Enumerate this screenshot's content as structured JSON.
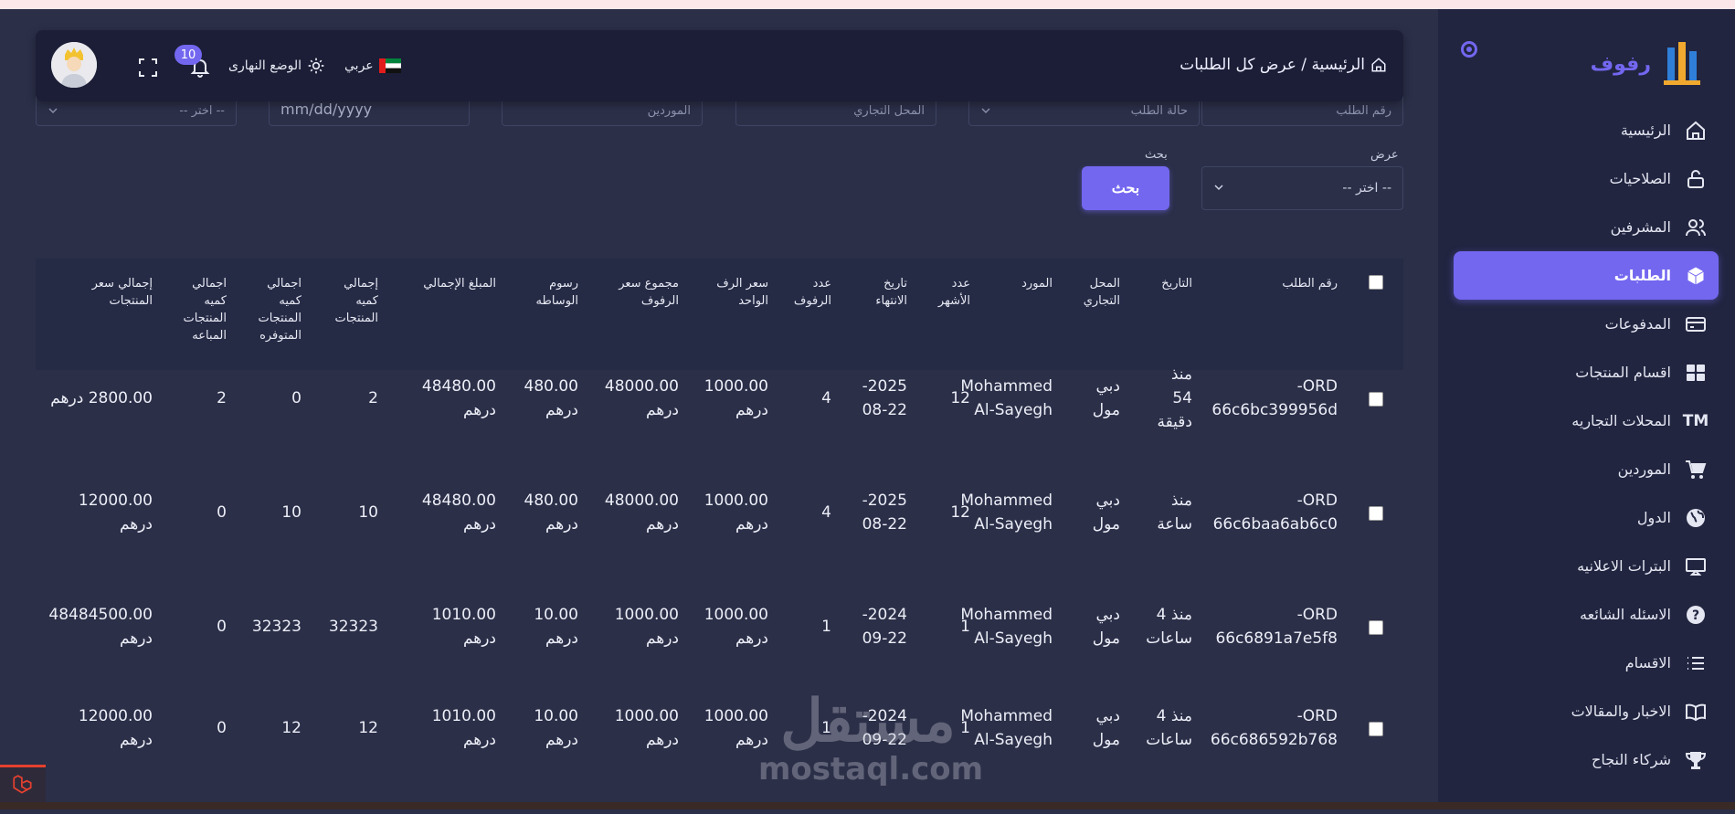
{
  "app": {
    "brand": "رفوف",
    "accent": "#7367f0"
  },
  "sidebar": {
    "items": [
      {
        "label": "الرئيسية",
        "icon": "home-icon"
      },
      {
        "label": "الصلاحيات",
        "icon": "lock-open-icon"
      },
      {
        "label": "المشرفين",
        "icon": "users-icon"
      },
      {
        "label": "الطلبات",
        "icon": "box-icon",
        "active": true
      },
      {
        "label": "المدفوعات",
        "icon": "credit-card-icon"
      },
      {
        "label": "اقسام المنتجات",
        "icon": "grid-icon"
      },
      {
        "label": "المحلات التجاريه",
        "icon": "trademark-icon"
      },
      {
        "label": "الموردين",
        "icon": "cart-icon"
      },
      {
        "label": "الدول",
        "icon": "globe-icon"
      },
      {
        "label": "البترات الاعلانيه",
        "icon": "monitor-icon"
      },
      {
        "label": "الاسئله الشائعه",
        "icon": "question-icon"
      },
      {
        "label": "الاقسام",
        "icon": "list-icon"
      },
      {
        "label": "الاخبار والمقالات",
        "icon": "book-icon"
      },
      {
        "label": "شركاء النجاح",
        "icon": "trophy-icon"
      }
    ]
  },
  "header": {
    "breadcrumb": "الرئيسية / عرض كل الطلبات",
    "language": "عربي",
    "theme_mode": "الوضع النهارى",
    "notifications_count": "10"
  },
  "filters": {
    "row1": [
      "رقم الطلب",
      "حالة الطلب",
      "المحل التجاري",
      "الموردين",
      "mm/dd/yyyy",
      "-- اختر --"
    ],
    "show_label": "عرض",
    "show_value": "-- اختر --",
    "search_label": "بحث",
    "search_button": "بحث"
  },
  "table": {
    "headers": [
      "رقم الطلب",
      "التاريخ",
      "المحل التجاري",
      "المورد",
      "عدد الأشهر",
      "تاريخ الانتهاء",
      "عدد الرفوف",
      "سعر الرف الواحد",
      "مجموع سعر الرفوف",
      "رسوم الوساطه",
      "المبلغ الإجمالي",
      "إجمالي كميه المنتجات",
      "اجمالي كميه المنتجات المتوفره",
      "اجمالي كميه المنتجات المباعه",
      "إجمالي سعر المنتجات"
    ],
    "rows": [
      [
        "ORD-\n66c6bc399956d",
        "منذ\n54\nدقيقة",
        "دبي\nمول",
        "Mohammed\nAl-Sayegh",
        "12",
        "2025-\n08-22",
        "4",
        "1000.00\nدرهم",
        "48000.00\nدرهم",
        "480.00\nدرهم",
        "48480.00\nدرهم",
        "2",
        "0",
        "2",
        "2800.00 درهم"
      ],
      [
        "ORD-\n66c6baa6ab6c0",
        "منذ\nساعة",
        "دبي\nمول",
        "Mohammed\nAl-Sayegh",
        "12",
        "2025-\n08-22",
        "4",
        "1000.00\nدرهم",
        "48000.00\nدرهم",
        "480.00\nدرهم",
        "48480.00\nدرهم",
        "10",
        "10",
        "0",
        "12000.00\nدرهم"
      ],
      [
        "ORD-\n66c6891a7e5f8",
        "منذ 4\nساعات",
        "دبي\nمول",
        "Mohammed\nAl-Sayegh",
        "1",
        "2024-\n09-22",
        "1",
        "1000.00\nدرهم",
        "1000.00\nدرهم",
        "10.00\nدرهم",
        "1010.00\nدرهم",
        "32323",
        "32323",
        "0",
        "48484500.00\nدرهم"
      ],
      [
        "ORD-\n66c686592b768",
        "منذ 4\nساعات",
        "دبي\nمول",
        "Mohammed\nAl-Sayegh",
        "1",
        "2024-\n09-22",
        "1",
        "1000.00\nدرهم",
        "1000.00\nدرهم",
        "10.00\nدرهم",
        "1010.00\nدرهم",
        "12",
        "12",
        "0",
        "12000.00\nدرهم"
      ]
    ]
  },
  "watermark": {
    "arabic": "مستقل",
    "latin": "mostaql.com"
  }
}
